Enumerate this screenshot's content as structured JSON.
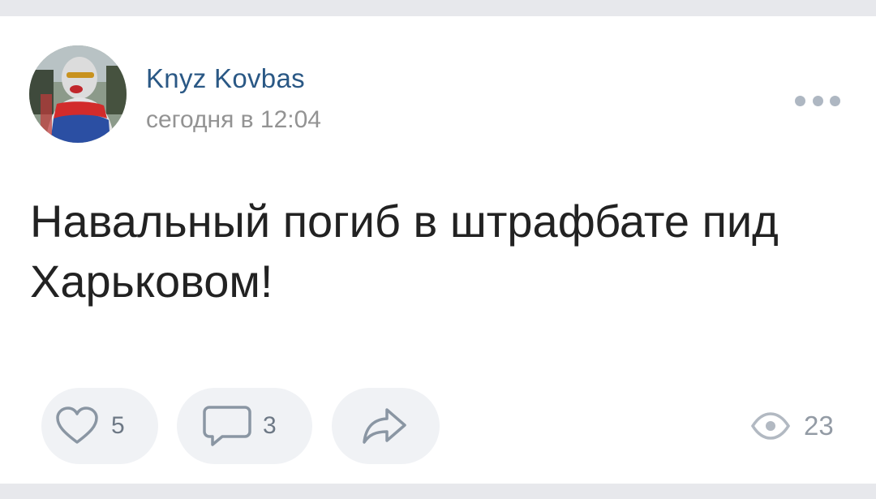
{
  "post": {
    "author": "Knyz Kovbas",
    "timestamp": "сегодня в 12:04",
    "text": "Навальный погиб в штрафбате пид Харьковом!"
  },
  "actions": {
    "like": {
      "count": "5",
      "icon": "heart-icon"
    },
    "comment": {
      "count": "3",
      "icon": "comment-icon"
    },
    "share": {
      "icon": "share-arrow-icon"
    }
  },
  "views": {
    "count": "23",
    "icon": "eye-icon"
  },
  "colors": {
    "author": "#2a5885",
    "muted": "#939393",
    "button_bg": "#f0f2f5",
    "icon": "#8a96a3"
  }
}
